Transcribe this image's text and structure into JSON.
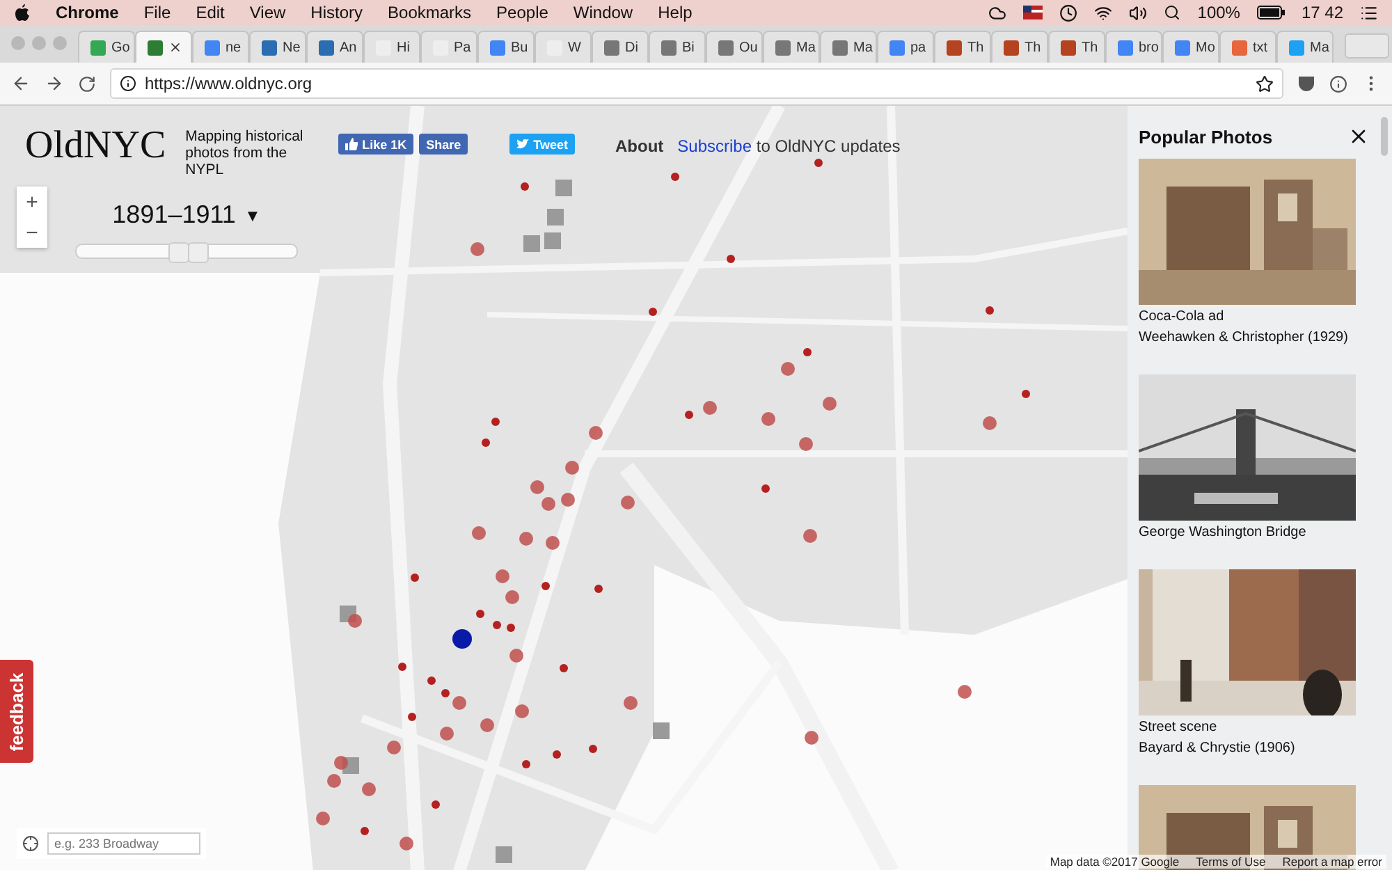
{
  "menu_bar": {
    "app": "Chrome",
    "items": [
      "File",
      "Edit",
      "View",
      "History",
      "Bookmarks",
      "People",
      "Window",
      "Help"
    ],
    "battery": "100%",
    "clock": "17 42"
  },
  "tabs": [
    {
      "title": "Go",
      "selected": false
    },
    {
      "selected": true
    },
    {
      "title": "ne",
      "selected": false
    },
    {
      "title": "Ne",
      "selected": false
    },
    {
      "title": "An",
      "selected": false
    },
    {
      "title": "Hi",
      "selected": false
    },
    {
      "title": "Pa",
      "selected": false
    },
    {
      "title": "Bu",
      "selected": false
    },
    {
      "title": "W",
      "selected": false
    },
    {
      "title": "Di",
      "selected": false
    },
    {
      "title": "Bi",
      "selected": false
    },
    {
      "title": "Ou",
      "selected": false
    },
    {
      "title": "Ma",
      "selected": false
    },
    {
      "title": "Ma",
      "selected": false
    },
    {
      "title": "pa",
      "selected": false
    },
    {
      "title": "Th",
      "selected": false
    },
    {
      "title": "Th",
      "selected": false
    },
    {
      "title": "Th",
      "selected": false
    },
    {
      "title": "bro",
      "selected": false
    },
    {
      "title": "Mo",
      "selected": false
    },
    {
      "title": "txt",
      "selected": false
    },
    {
      "title": "Ma",
      "selected": false
    }
  ],
  "address_bar": {
    "url": "https://www.oldnyc.org"
  },
  "header": {
    "logo": "OldNYC",
    "tagline": "Mapping historical photos from the NYPL",
    "like": "Like 1K",
    "share": "Share",
    "tweet": "Tweet"
  },
  "nav": {
    "about": "About",
    "subscribe": "Subscribe",
    "subscribe_rest": "to OldNYC updates"
  },
  "zoom": {
    "zoom_in": "+",
    "zoom_out": "−"
  },
  "year_filter": {
    "label": "1891–1911",
    "caret": "▼",
    "handles": [
      {
        "level": 0.46
      },
      {
        "level": 0.55
      }
    ]
  },
  "popular_photos": {
    "title": "Popular Photos",
    "photos": [
      {
        "kind": "building",
        "title": "Coca-Cola ad",
        "subtitle": "Weehawken & Christopher (1929)"
      },
      {
        "kind": "bridge",
        "title": "George Washington Bridge"
      },
      {
        "kind": "street",
        "title": "Street scene",
        "subtitle": "Bayard & Chrystie (1906)"
      },
      {
        "kind": "building"
      }
    ]
  },
  "feedback": "feedback",
  "search": {
    "placeholder": "e.g. 233 Broadway"
  },
  "attribution": [
    "Map data ©2017 Google",
    "Terms of Use",
    "Report a map error"
  ]
}
